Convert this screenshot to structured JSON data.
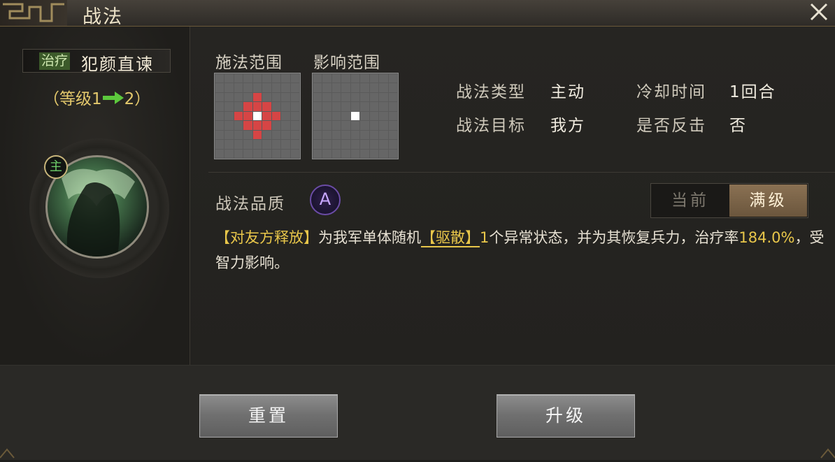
{
  "window": {
    "title": "战法",
    "close_icon": "close-icon"
  },
  "skill": {
    "tag": "治疗",
    "name": "犯颜直谏",
    "level_open": "（等级1",
    "level_close": "2）",
    "role_badge": "主",
    "portrait_icon": "general-portrait"
  },
  "grids": {
    "cast_label": "施法范围",
    "effect_label": "影响范围"
  },
  "info": {
    "type_label": "战法类型",
    "type_value": "主动",
    "cooldown_label": "冷却时间",
    "cooldown_value": "1回合",
    "target_label": "战法目标",
    "target_value": "我方",
    "counter_label": "是否反击",
    "counter_value": "否"
  },
  "quality": {
    "label": "战法品质",
    "grade": "A"
  },
  "toggle": {
    "current": "当前",
    "max": "满级",
    "selected": "满级"
  },
  "description": {
    "part1": "【对友方释放】",
    "part2": "为我军单体随机",
    "part3": "【驱散】",
    "part4": "1",
    "part5": "个异常状态，并为其恢复兵力，治疗率",
    "part6": "184.0%",
    "part7": "，受智力影响。"
  },
  "buttons": {
    "reset": "重置",
    "upgrade": "升级"
  },
  "colors": {
    "highlight": "#e8c64a",
    "range_red": "#d64545",
    "tag_green": "#3c5a2a"
  }
}
